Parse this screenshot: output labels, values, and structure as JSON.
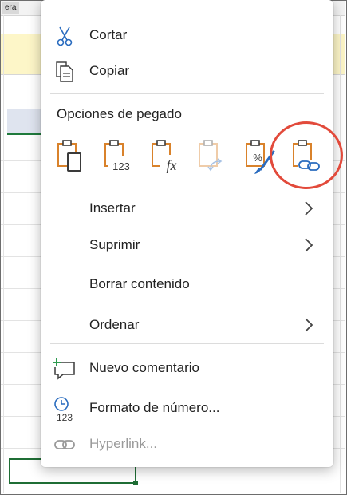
{
  "sheet": {
    "tab_label": "era"
  },
  "menu": {
    "cut_label": "Cortar",
    "copy_label": "Copiar",
    "paste_options_title": "Opciones de pegado",
    "paste_options": [
      {
        "name": "paste-icon",
        "caption": ""
      },
      {
        "name": "paste-values-icon",
        "caption": "123"
      },
      {
        "name": "paste-formulas-icon",
        "caption": "fx"
      },
      {
        "name": "paste-transpose-icon",
        "caption": ""
      },
      {
        "name": "paste-formatting-icon",
        "caption": "%"
      },
      {
        "name": "paste-link-icon",
        "caption": ""
      }
    ],
    "insert_label": "Insertar",
    "delete_label": "Suprimir",
    "clear_label": "Borrar contenido",
    "sort_label": "Ordenar",
    "new_comment_label": "Nuevo comentario",
    "number_format_label": "Formato de número...",
    "number_format_icon_caption": "123",
    "hyperlink_label": "Hyperlink..."
  },
  "colors": {
    "icon_orange": "#d9822b",
    "icon_dark": "#3a3a3a",
    "icon_blue": "#2a6cbf",
    "icon_green": "#2e9b4e",
    "highlight": "#e24a3b",
    "selection_green": "#1f6e35"
  }
}
